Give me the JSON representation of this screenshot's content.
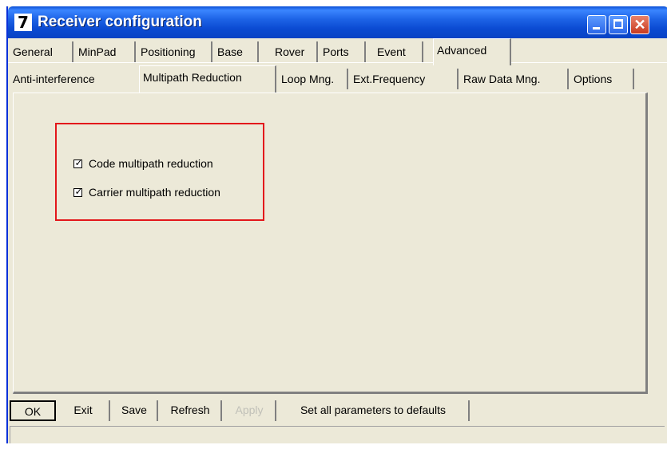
{
  "window": {
    "title": "Receiver configuration",
    "icon": "receiver-app-icon",
    "controls": [
      "minimize-icon",
      "maximize-icon",
      "close-icon"
    ]
  },
  "main_tabs": [
    {
      "label": "General"
    },
    {
      "label": "MinPad"
    },
    {
      "label": "Positioning"
    },
    {
      "label": "Base"
    },
    {
      "label": "Rover"
    },
    {
      "label": "Ports"
    },
    {
      "label": "Event"
    },
    {
      "label": "Advanced",
      "selected": true
    }
  ],
  "sub_tabs": [
    {
      "label": "Anti-interference"
    },
    {
      "label": "Multipath Reduction",
      "selected": true
    },
    {
      "label": "Loop Mng."
    },
    {
      "label": "Ext.Frequency"
    },
    {
      "label": "Raw Data Mng."
    },
    {
      "label": "Options"
    }
  ],
  "options": [
    {
      "label": "Code multipath reduction",
      "checked": true
    },
    {
      "label": "Carrier multipath reduction",
      "checked": true
    }
  ],
  "buttons": {
    "ok": "OK",
    "exit": "Exit",
    "save": "Save",
    "refresh": "Refresh",
    "apply": "Apply",
    "defaults": "Set all parameters to defaults"
  },
  "colors": {
    "titlebar": "#0b4ad2",
    "highlight_box": "#e3171b",
    "dialog_bg": "#ece9d8"
  }
}
